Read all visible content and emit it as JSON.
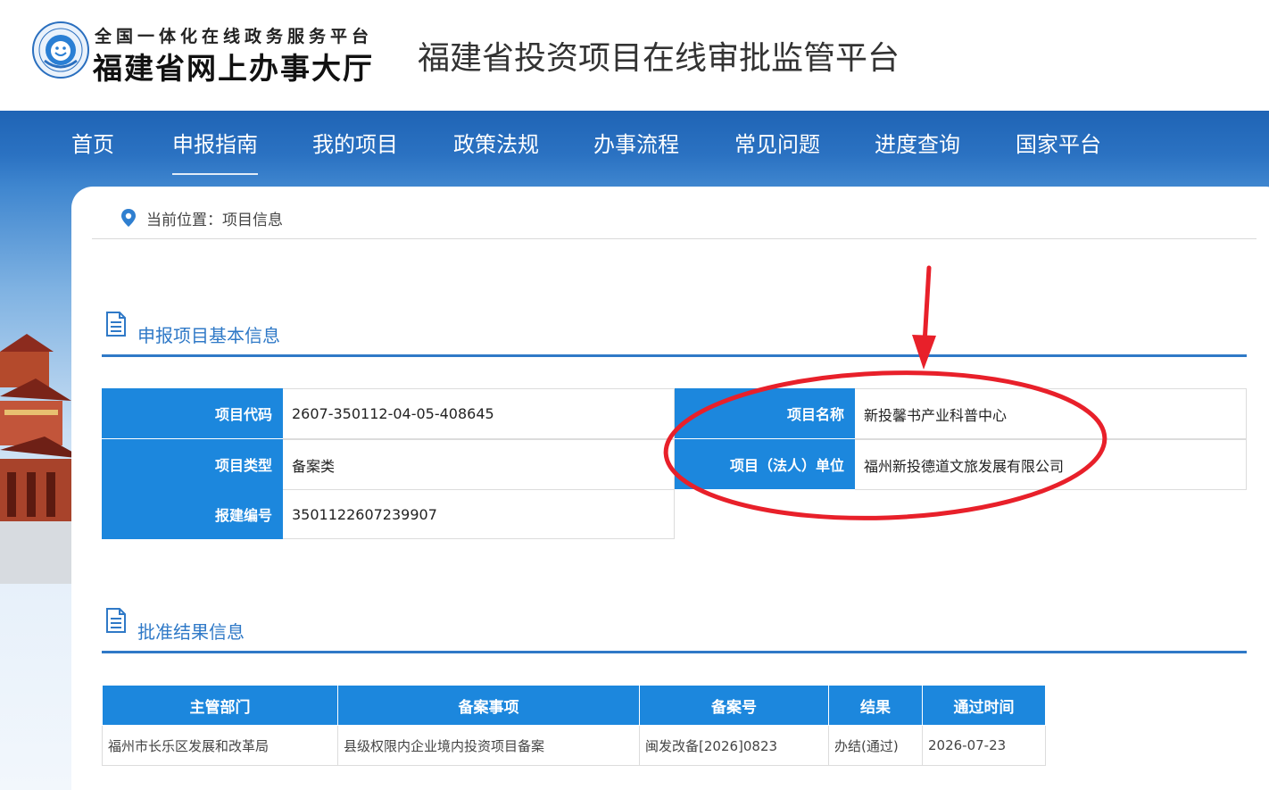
{
  "header": {
    "logo_small": "全国一体化在线政务服务平台",
    "logo_big": "福建省网上办事大厅",
    "site_title": "福建省投资项目在线审批监管平台"
  },
  "nav": {
    "items": [
      {
        "label": "首页"
      },
      {
        "label": "申报指南",
        "active": true
      },
      {
        "label": "我的项目"
      },
      {
        "label": "政策法规"
      },
      {
        "label": "办事流程"
      },
      {
        "label": "常见问题"
      },
      {
        "label": "进度查询"
      },
      {
        "label": "国家平台"
      }
    ]
  },
  "breadcrumb": {
    "text": "当前位置：项目信息",
    "icon": "location-pin-icon"
  },
  "basic_info": {
    "title": "申报项目基本信息",
    "fields": {
      "project_code_label": "项目代码",
      "project_code": "2607-350112-04-05-408645",
      "project_name_label": "项目名称",
      "project_name": "新投馨书产业科普中心",
      "project_type_label": "项目类型",
      "project_type": "备案类",
      "unit_label": "项目（法人）单位",
      "unit": "福州新投德道文旅发展有限公司",
      "build_no_label": "报建编号",
      "build_no": "3501122607239907"
    }
  },
  "approval": {
    "title": "批准结果信息",
    "columns": [
      "主管部门",
      "备案事项",
      "备案号",
      "结果",
      "通过时间"
    ],
    "rows": [
      [
        "福州市长乐区发展和改革局",
        "县级权限内企业境内投资项目备案",
        "闽发改备[2026]0823",
        "办结(通过)",
        "2026-07-23"
      ]
    ]
  },
  "colors": {
    "primary": "#1c87dd",
    "section_title": "#2f79c7",
    "nav_bg": "#1f64b5",
    "annotation": "#e8202a"
  }
}
